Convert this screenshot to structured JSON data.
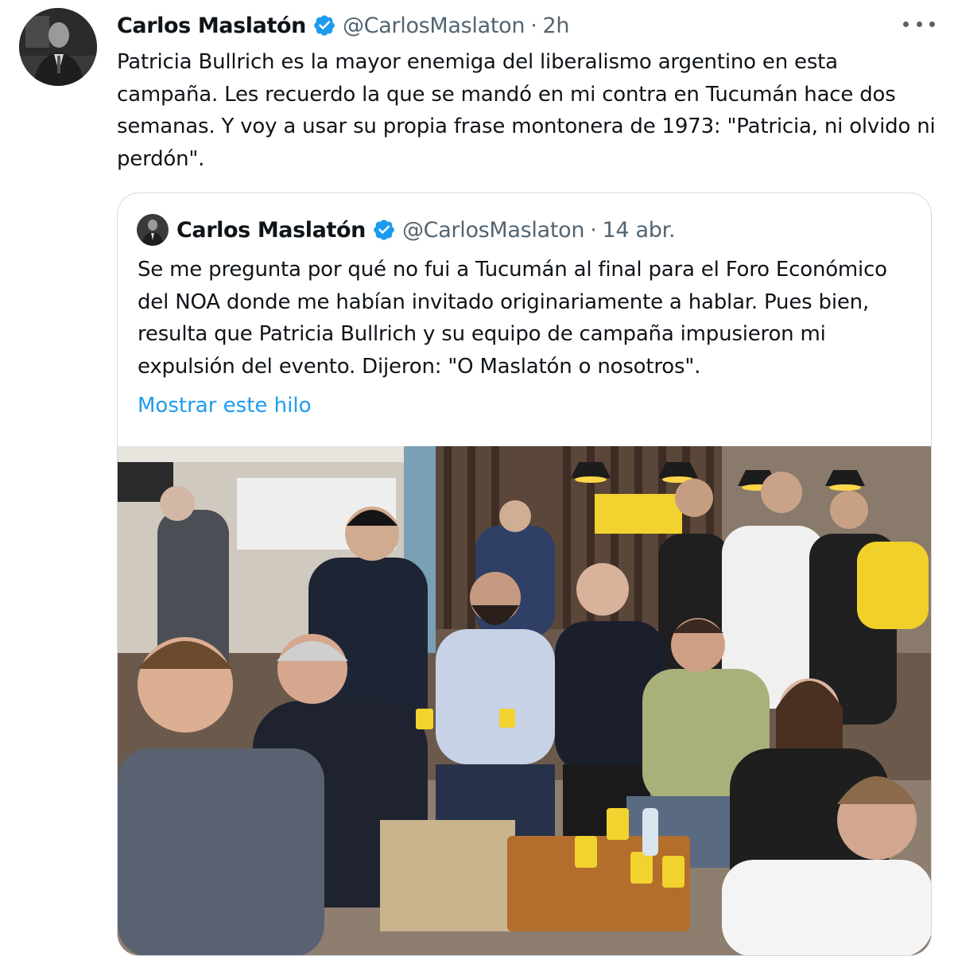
{
  "tweet": {
    "author": {
      "display_name": "Carlos Maslatón",
      "handle": "@CarlosMaslaton",
      "verified": true
    },
    "separator": "·",
    "timestamp": "2h",
    "text": "Patricia Bullrich es la mayor enemiga del liberalismo argentino en esta campaña. Les recuerdo la que se mandó en mi contra en Tucumán hace dos semanas. Y voy a usar su propia frase montonera de 1973: \"Patricia, ni olvido ni perdón\".",
    "more_icon": "more-horizontal-icon"
  },
  "quoted_tweet": {
    "author": {
      "display_name": "Carlos Maslatón",
      "handle": "@CarlosMaslaton",
      "verified": true
    },
    "separator": "·",
    "timestamp": "14 abr.",
    "text": "Se me pregunta por qué no fui a Tucumán al final para el Foro Económico del NOA donde me habían invitado originariamente a hablar. Pues bien, resulta que Patricia Bullrich y su equipo de campaña impusieron mi expulsión del evento. Dijeron: \"O Maslatón o nosotros\".",
    "show_thread_label": "Mostrar este hilo",
    "media": "group-photo"
  },
  "colors": {
    "text": "#0f1419",
    "secondary_text": "#536471",
    "link": "#1d9bf0",
    "verified_badge": "#1d9bf0",
    "border": "#cfd9de"
  }
}
